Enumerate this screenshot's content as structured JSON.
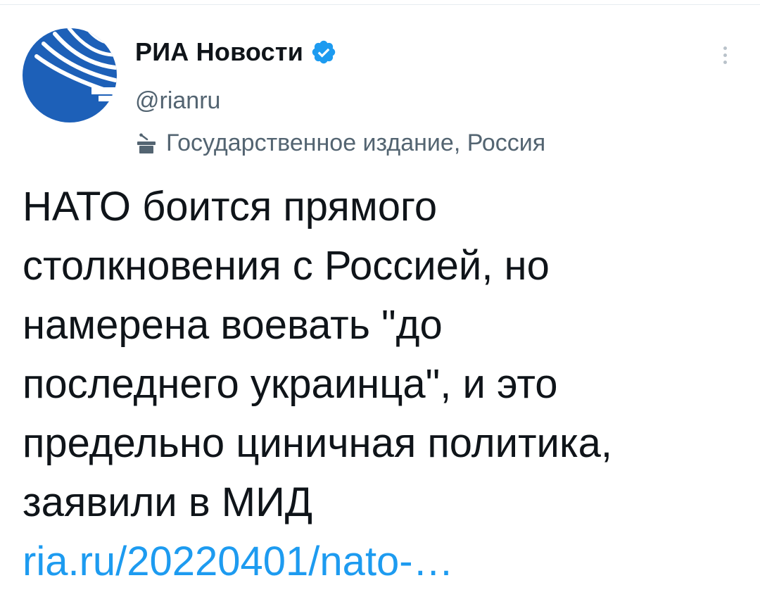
{
  "account": {
    "display_name": "РИА Новости",
    "handle": "@rianru",
    "label": "Государственное издание, Россия",
    "verified": true,
    "brand_color": "#1d60b8",
    "verified_color": "#1d9bf0"
  },
  "tweet": {
    "text": "НАТО боится прямого\nстолкновения с Россией, но\nнамерена воевать \"до\nпоследнего украинца\", и это\nпредельно циничная политика,\nзаявили в МИД",
    "link": "ria.ru/20220401/nato-…",
    "link_color": "#1d9bf0"
  },
  "icons": {
    "avatar": "ria-novosti-logo-icon",
    "verified": "verified-badge-icon",
    "label": "government-podium-icon",
    "more": "more-options-icon"
  }
}
